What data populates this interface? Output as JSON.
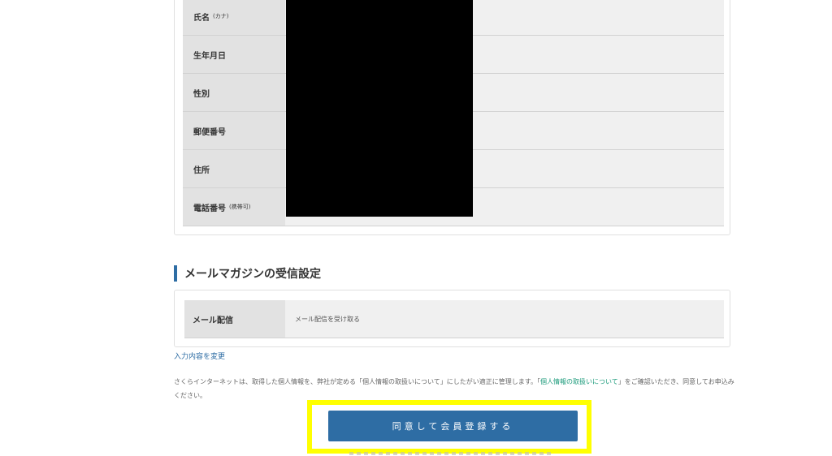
{
  "profile_table": {
    "rows": [
      {
        "label": "氏名",
        "sub": "(カナ)"
      },
      {
        "label": "生年月日",
        "sub": ""
      },
      {
        "label": "性別",
        "sub": ""
      },
      {
        "label": "郵便番号",
        "sub": ""
      },
      {
        "label": "住所",
        "sub": ""
      },
      {
        "label": "電話番号",
        "sub": "(携帯可)"
      }
    ]
  },
  "mail_section": {
    "heading": "メールマガジンの受信設定",
    "row_label": "メール配信",
    "row_value": "メール配信を受け取る"
  },
  "edit_link": "入力内容を変更",
  "notice": {
    "part1": "さくらインターネットは、取得した個人情報を、弊社が定める「個人情報の取扱いについて」にしたがい適正に管理します。「",
    "link": "個人情報の取扱いについて",
    "part2": "」をご確認いただき、同意してお申込みください。"
  },
  "submit_button": "同意して会員登録する",
  "colors": {
    "accent": "#2e6da4",
    "highlight": "#ffff00",
    "link_green": "#1a9a7a"
  }
}
